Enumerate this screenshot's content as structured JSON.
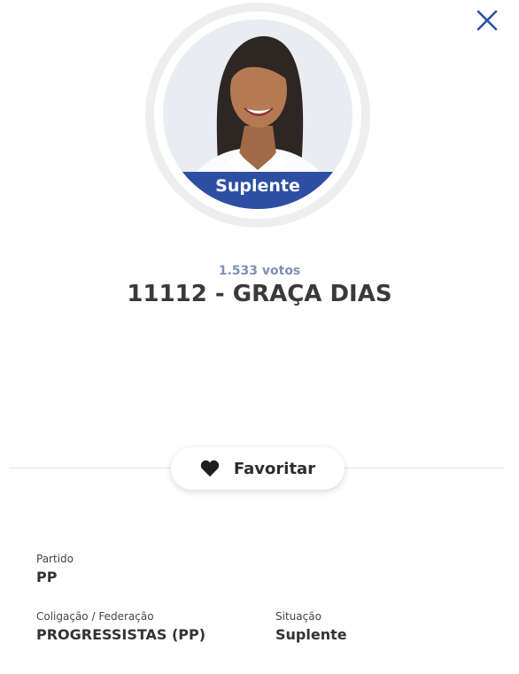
{
  "icons": {
    "close": "close-icon",
    "favorite": "heart-icon"
  },
  "colors": {
    "accent": "#2d4fa3",
    "votes_text": "#7f90b4",
    "close_icon": "#2d4fa3"
  },
  "candidate": {
    "status_badge": "Suplente",
    "votes": "1.533 votos",
    "name": "11112 - GRAÇA DIAS"
  },
  "favorite": {
    "label": "Favoritar"
  },
  "details": {
    "party_label": "Partido",
    "party_value": "PP",
    "coalition_label": "Coligação / Federação",
    "coalition_value": "PROGRESSISTAS (PP)",
    "situation_label": "Situação",
    "situation_value": "Suplente"
  }
}
